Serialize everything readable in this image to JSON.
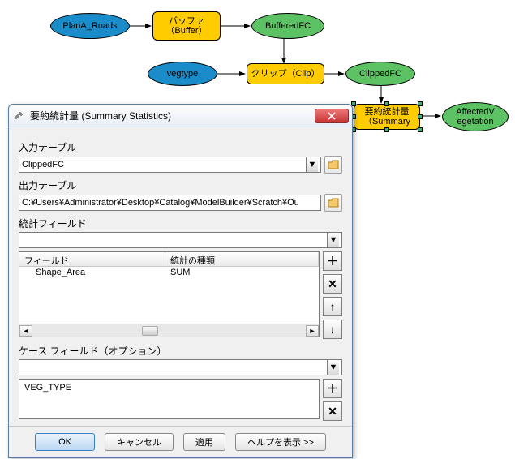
{
  "model": {
    "node_plan_a": "PlanA_Roads",
    "node_buffer": "バッファ\n（Buffer）",
    "node_bufferedfc": "BufferedFC",
    "node_vegtype": "vegtype",
    "node_clip": "クリップ（Clip）",
    "node_clippedfc": "ClippedFC",
    "node_summary": "要約統計量\n（Summary",
    "node_affected": "AffectedV\negetation"
  },
  "dialog": {
    "title": "要約統計量 (Summary Statistics)",
    "label_input_table": "入力テーブル",
    "input_table_value": "ClippedFC",
    "label_output_table": "出力テーブル",
    "output_table_value": "C:¥Users¥Administrator¥Desktop¥Catalog¥ModelBuilder¥Scratch¥Ou",
    "label_stat_fields": "統計フィールド",
    "header_field": "フィールド",
    "header_stat_type": "統計の種類",
    "row1_field": "Shape_Area",
    "row1_stat": "SUM",
    "label_case_field": "ケース フィールド（オプション）",
    "case_value": "VEG_TYPE",
    "btn_ok": "OK",
    "btn_cancel": "キャンセル",
    "btn_apply": "適用",
    "btn_help": "ヘルプを表示 >>"
  }
}
